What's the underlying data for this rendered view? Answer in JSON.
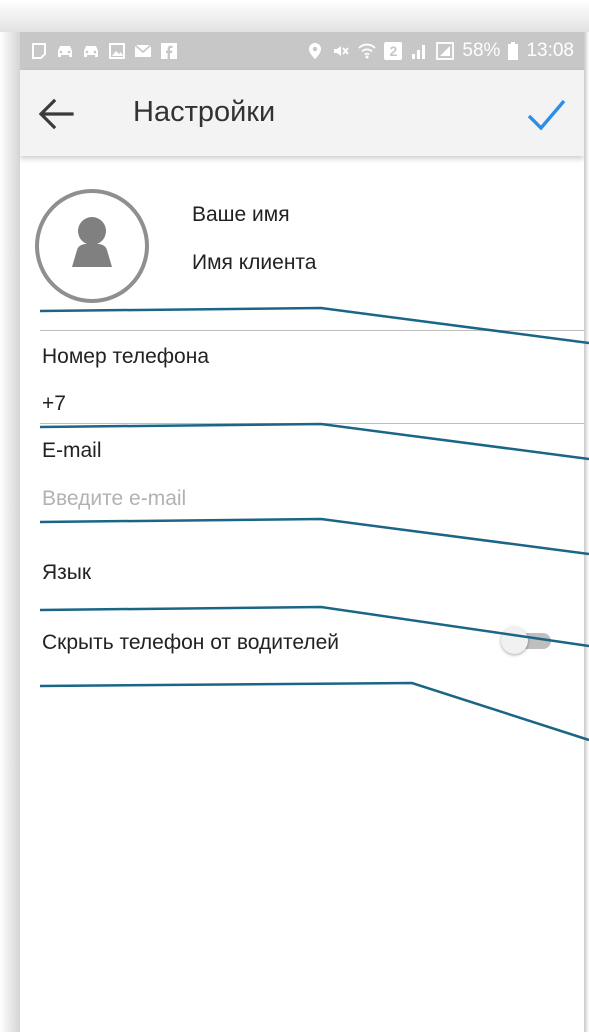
{
  "status_bar": {
    "battery": "58%",
    "time": "13:08",
    "sim_badge": "2",
    "left_icons": [
      "notification-icon",
      "car-icon",
      "car-icon",
      "image-icon",
      "mail-icon",
      "facebook-icon"
    ],
    "right_icons": [
      "location-icon",
      "mute-icon",
      "wifi-icon",
      "sim-badge",
      "signal-icon",
      "signal-icon",
      "battery-icon"
    ]
  },
  "app_bar": {
    "title": "Настройки",
    "back_icon": "arrow-left-icon",
    "confirm_icon": "checkmark-icon"
  },
  "profile": {
    "name_label": "Ваше имя",
    "name_value": "Имя клиента"
  },
  "phone": {
    "label": "Номер телефона",
    "value": "+7"
  },
  "email": {
    "label": "E-mail",
    "placeholder": "Введите e-mail"
  },
  "language": {
    "label": "Язык"
  },
  "hide_phone": {
    "label": "Скрыть телефон от водителей",
    "enabled": false
  },
  "colors": {
    "accent": "#2b8fe8",
    "annotation_line": "#1b6586",
    "status_bar": "#c7c7c7",
    "app_bar": "#f3f3f3"
  }
}
